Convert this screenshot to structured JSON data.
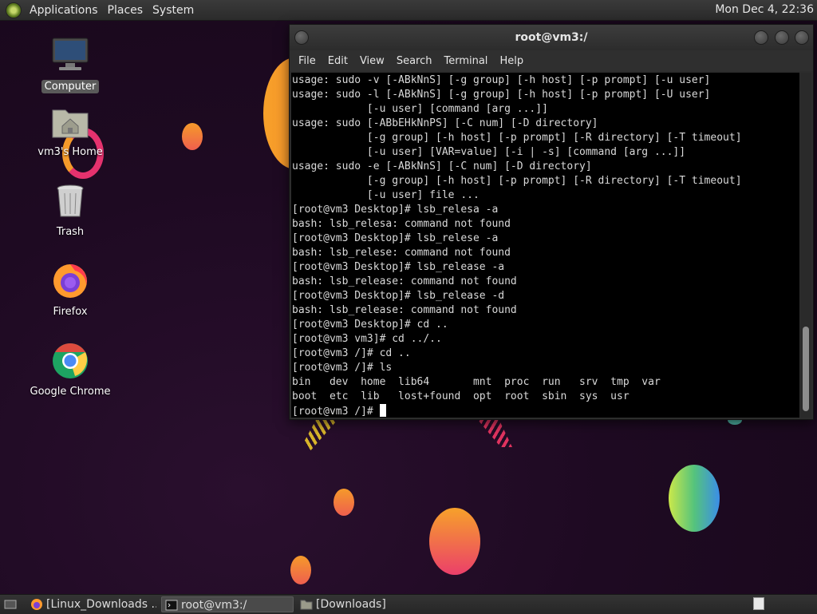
{
  "top_panel": {
    "menus": [
      "Applications",
      "Places",
      "System"
    ],
    "clock": "Mon Dec  4, 22:36"
  },
  "desktop_icons": [
    {
      "label": "Computer",
      "icon": "computer-icon"
    },
    {
      "label": "vm3's Home",
      "icon": "home-folder-icon"
    },
    {
      "label": "Trash",
      "icon": "trash-icon"
    },
    {
      "label": "Firefox",
      "icon": "firefox-icon"
    },
    {
      "label": "Google Chrome",
      "icon": "chrome-icon"
    }
  ],
  "terminal": {
    "title": "root@vm3:/",
    "menu": [
      "File",
      "Edit",
      "View",
      "Search",
      "Terminal",
      "Help"
    ],
    "lines": [
      "usage: sudo -v [-ABkNnS] [-g group] [-h host] [-p prompt] [-u user]",
      "usage: sudo -l [-ABkNnS] [-g group] [-h host] [-p prompt] [-U user]",
      "            [-u user] [command [arg ...]]",
      "usage: sudo [-ABbEHkNnPS] [-C num] [-D directory]",
      "            [-g group] [-h host] [-p prompt] [-R directory] [-T timeout]",
      "            [-u user] [VAR=value] [-i | -s] [command [arg ...]]",
      "usage: sudo -e [-ABkNnS] [-C num] [-D directory]",
      "            [-g group] [-h host] [-p prompt] [-R directory] [-T timeout]",
      "            [-u user] file ...",
      "[root@vm3 Desktop]# lsb_relesa -a",
      "bash: lsb_relesa: command not found",
      "[root@vm3 Desktop]# lsb_relese -a",
      "bash: lsb_relese: command not found",
      "[root@vm3 Desktop]# lsb_release -a",
      "bash: lsb_release: command not found",
      "[root@vm3 Desktop]# lsb_release -d",
      "bash: lsb_release: command not found",
      "[root@vm3 Desktop]# cd ..",
      "[root@vm3 vm3]# cd ../..",
      "[root@vm3 /]# cd ..",
      "[root@vm3 /]# ls",
      "bin   dev  home  lib64       mnt  proc  run   srv  tmp  var",
      "boot  etc  lib   lost+found  opt  root  sbin  sys  usr"
    ],
    "prompt": "[root@vm3 /]# "
  },
  "taskbar": {
    "items": [
      {
        "label": "[Linux_Downloads ...",
        "icon": "firefox-icon",
        "active": false
      },
      {
        "label": "root@vm3:/",
        "icon": "terminal-icon",
        "active": true
      },
      {
        "label": "[Downloads]",
        "icon": "folder-icon",
        "active": false
      }
    ]
  },
  "colors": {
    "background": "#1e0a22",
    "panel": "#2b2b2b",
    "terminal_bg": "#000000",
    "terminal_fg": "#d9d9d9"
  }
}
